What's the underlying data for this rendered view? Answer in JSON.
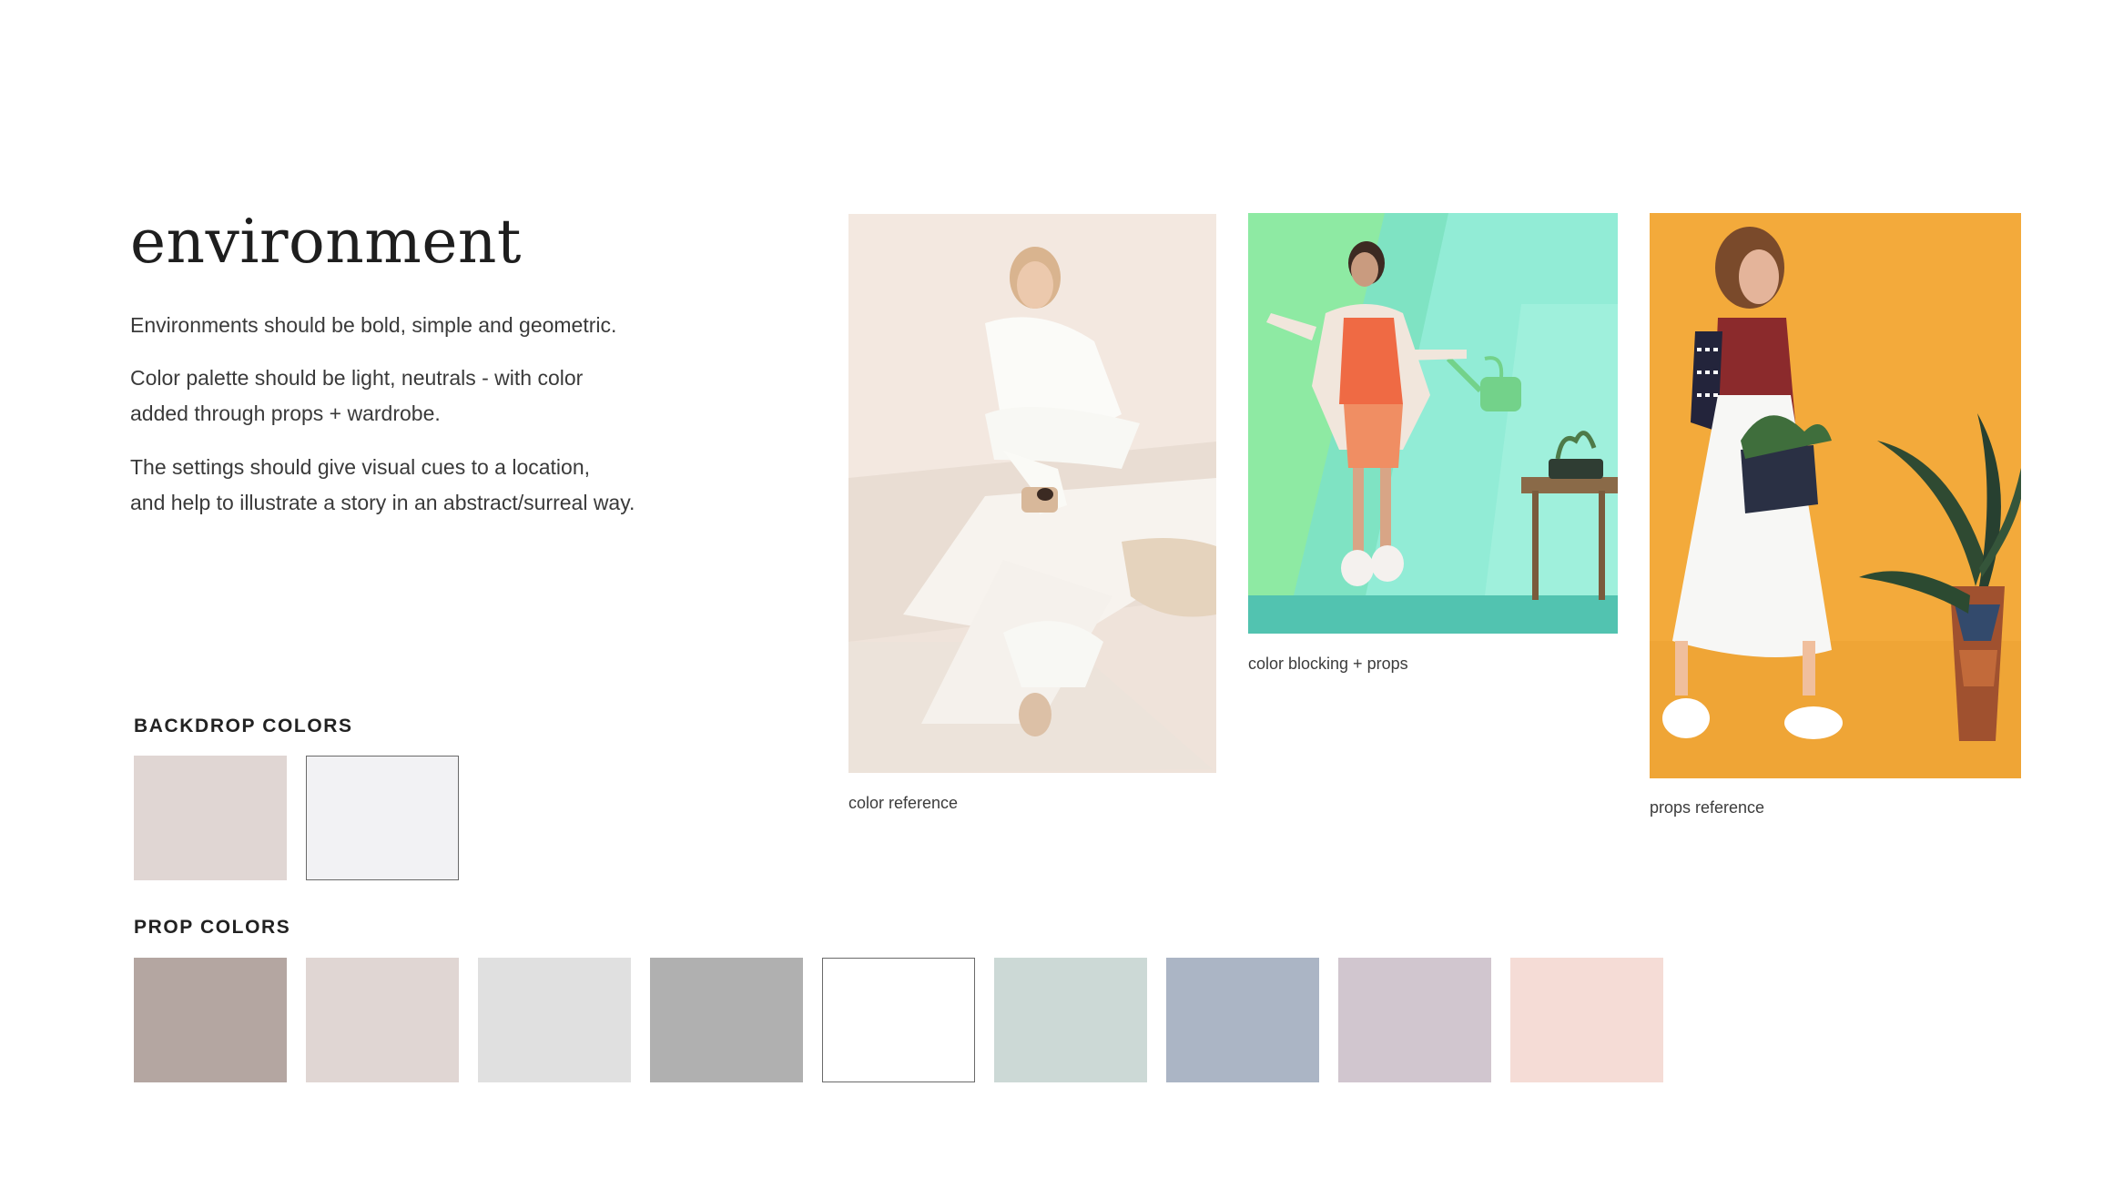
{
  "title": "environment",
  "paragraphs": [
    "Environments should be bold, simple and geometric.",
    "Color palette should be light, neutrals - with color\nadded through props + wardrobe.",
    "The settings should give visual cues to a location,\nand help to illustrate a story in an abstract/surreal way."
  ],
  "backdrop": {
    "heading": "BACKDROP COLORS",
    "swatches": [
      "#e0d6d3",
      "#f2f2f4"
    ]
  },
  "props": {
    "heading": "PROP COLORS",
    "swatches": [
      "#b4a6a1",
      "#e0d6d3",
      "#e0e0e0",
      "#b0b0b0",
      "#ffffff",
      "#ccd9d6",
      "#abb5c5",
      "#d1c6cf",
      "#f5dcd6"
    ]
  },
  "photos": [
    {
      "caption": "color reference",
      "icon": "photo-model-white-outfit-mirror"
    },
    {
      "caption": "color blocking + props",
      "icon": "photo-model-mint-backdrop-watering-can"
    },
    {
      "caption": "props reference",
      "icon": "photo-model-orange-backdrop-plants"
    }
  ]
}
